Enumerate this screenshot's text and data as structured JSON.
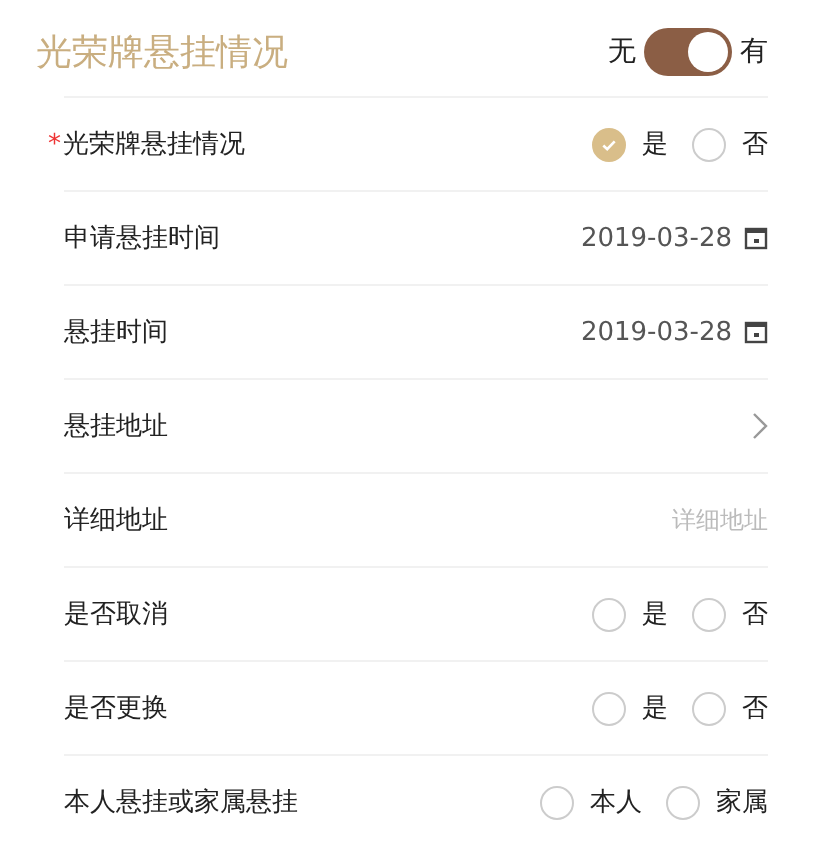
{
  "header": {
    "title": "光荣牌悬挂情况",
    "toggle": {
      "off_label": "无",
      "on_label": "有",
      "on": true
    }
  },
  "rows": [
    {
      "kind": "radio",
      "label": "光荣牌悬挂情况",
      "required_mark": "*",
      "options": [
        {
          "label": "是",
          "selected": true
        },
        {
          "label": "否",
          "selected": false
        }
      ]
    },
    {
      "kind": "date",
      "label": "申请悬挂时间",
      "value": "2019-03-28"
    },
    {
      "kind": "date",
      "label": "悬挂时间",
      "value": "2019-03-28"
    },
    {
      "kind": "link",
      "label": "悬挂地址"
    },
    {
      "kind": "input",
      "label": "详细地址",
      "placeholder": "详细地址"
    },
    {
      "kind": "radio",
      "label": "是否取消",
      "options": [
        {
          "label": "是",
          "selected": false
        },
        {
          "label": "否",
          "selected": false
        }
      ]
    },
    {
      "kind": "radio",
      "label": "是否更换",
      "options": [
        {
          "label": "是",
          "selected": false
        },
        {
          "label": "否",
          "selected": false
        }
      ]
    },
    {
      "kind": "radio",
      "label": "本人悬挂或家属悬挂",
      "options": [
        {
          "label": "本人",
          "selected": false
        },
        {
          "label": "家属",
          "selected": false
        }
      ]
    }
  ]
}
